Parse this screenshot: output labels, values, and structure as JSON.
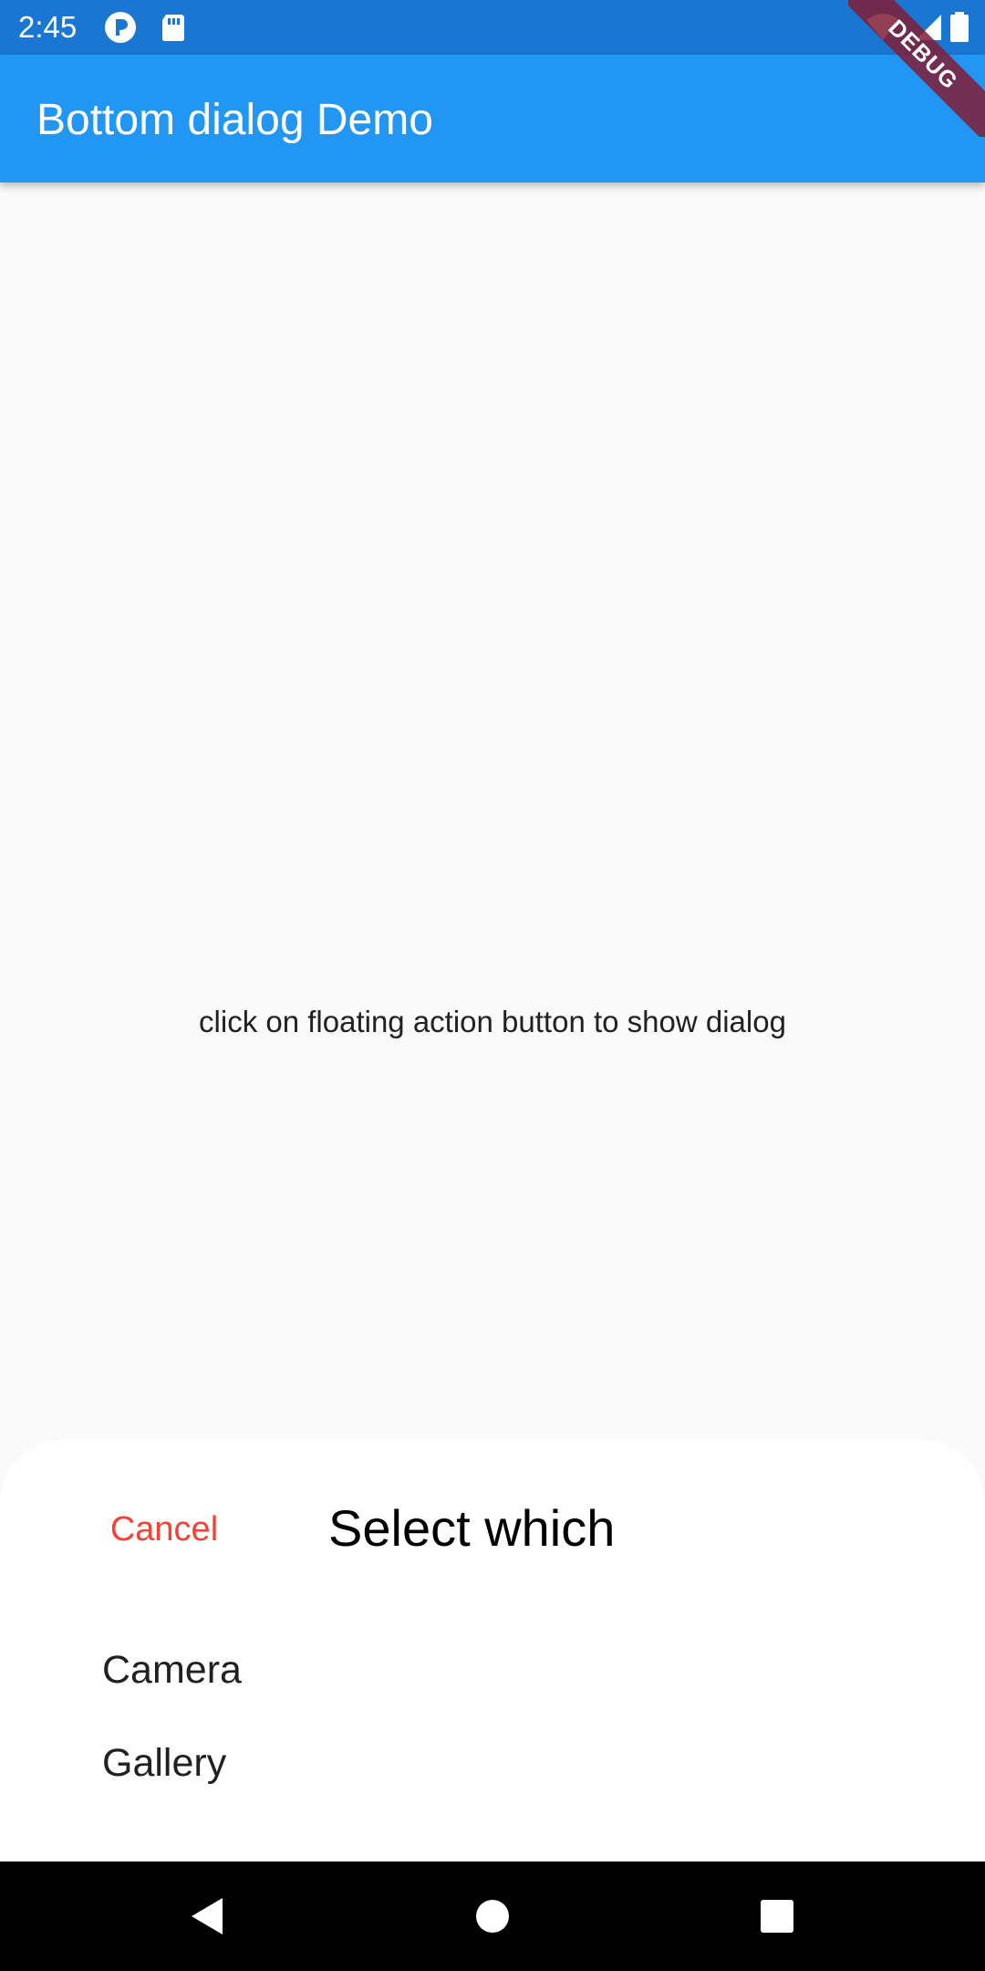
{
  "status_bar": {
    "time": "2:45",
    "left_icons": [
      "pocket-casts-icon",
      "sd-card-icon"
    ],
    "right_icons": [
      "wifi-icon",
      "signal-icon",
      "battery-icon"
    ]
  },
  "app_bar": {
    "title": "Bottom dialog Demo",
    "color": "#2196f3"
  },
  "debug_banner": {
    "label": "DEBUG"
  },
  "body": {
    "message": "click on floating action button to show dialog"
  },
  "bottom_sheet": {
    "cancel_label": "Cancel",
    "cancel_color": "#f44336",
    "title": "Select which",
    "options": [
      {
        "label": "Camera"
      },
      {
        "label": "Gallery"
      }
    ]
  },
  "nav_bar": {
    "buttons": [
      "back-icon",
      "home-icon",
      "recents-icon"
    ]
  }
}
